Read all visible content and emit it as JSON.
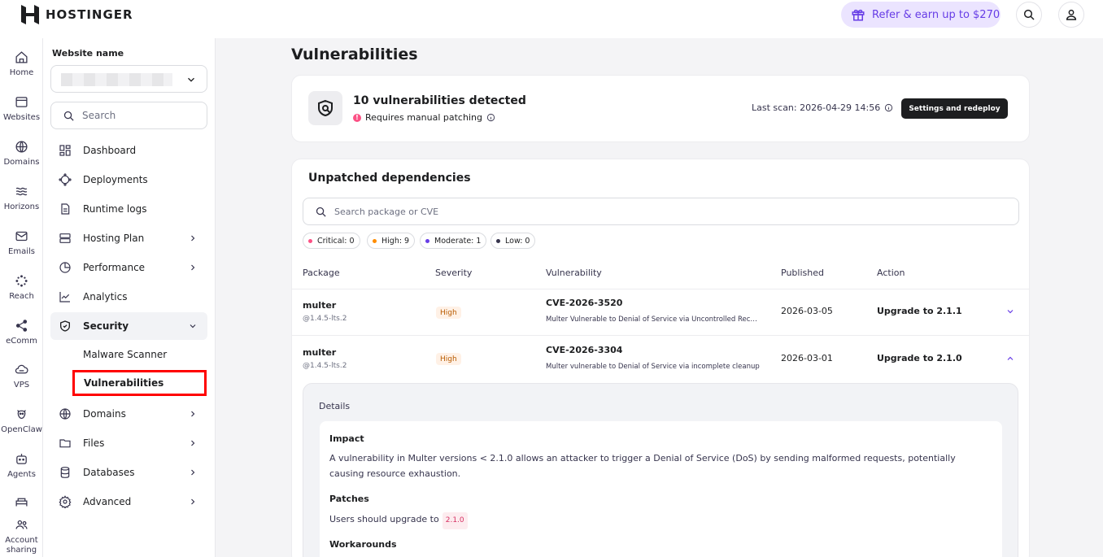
{
  "brand": {
    "name": "HOSTINGER"
  },
  "header": {
    "refer_label": "Refer & earn up to $270"
  },
  "rail": [
    {
      "label": "Home",
      "icon": "home-icon"
    },
    {
      "label": "Websites",
      "icon": "websites-icon"
    },
    {
      "label": "Domains",
      "icon": "globe-icon"
    },
    {
      "label": "Horizons",
      "icon": "horizons-icon"
    },
    {
      "label": "Emails",
      "icon": "mail-icon"
    },
    {
      "label": "Reach",
      "icon": "reach-icon"
    },
    {
      "label": "eComm",
      "icon": "ecomm-icon"
    },
    {
      "label": "VPS",
      "icon": "vps-icon"
    },
    {
      "label": "OpenClaw",
      "icon": "openclaw-icon"
    },
    {
      "label": "Agents",
      "icon": "agents-icon"
    },
    {
      "label": "",
      "icon": "bed-icon"
    },
    {
      "label": "Account sharing",
      "icon": "account-sharing-icon"
    }
  ],
  "sidebar": {
    "website_label": "Website name",
    "search_placeholder": "Search",
    "items": [
      {
        "label": "Dashboard"
      },
      {
        "label": "Deployments"
      },
      {
        "label": "Runtime logs"
      },
      {
        "label": "Hosting Plan"
      },
      {
        "label": "Performance"
      },
      {
        "label": "Analytics"
      },
      {
        "label": "Security"
      },
      {
        "label": "Domains"
      },
      {
        "label": "Files"
      },
      {
        "label": "Databases"
      },
      {
        "label": "Advanced"
      }
    ],
    "security_sub": [
      {
        "label": "Malware Scanner"
      },
      {
        "label": "Vulnerabilities"
      }
    ]
  },
  "page": {
    "title": "Vulnerabilities"
  },
  "scan": {
    "count_text": "10 vulnerabilities detected",
    "status_text": "Requires manual patching",
    "last_scan": "Last scan: 2026-04-29 14:56",
    "button": "Settings and redeploy"
  },
  "deps": {
    "title": "Unpatched dependencies",
    "search_placeholder": "Search package or CVE",
    "chips": [
      {
        "label": "Critical: 0",
        "color": "#fc5185"
      },
      {
        "label": "High: 9",
        "color": "#ff8c00"
      },
      {
        "label": "Moderate: 1",
        "color": "#673de6"
      },
      {
        "label": "Low: 0",
        "color": "#36344d"
      }
    ],
    "columns": [
      "Package",
      "Severity",
      "Vulnerability",
      "Published",
      "Action"
    ],
    "rows": [
      {
        "package": "multer",
        "version": "@1.4.5-lts.2",
        "severity": "High",
        "cve": "CVE-2026-3520",
        "desc": "Multer Vulnerable to Denial of Service via Uncontrolled Recursion",
        "published": "2026-03-05",
        "action": "Upgrade to 2.1.1"
      },
      {
        "package": "multer",
        "version": "@1.4.5-lts.2",
        "severity": "High",
        "cve": "CVE-2026-3304",
        "desc": "Multer vulnerable to Denial of Service via incomplete cleanup",
        "published": "2026-03-01",
        "action": "Upgrade to 2.1.0"
      }
    ],
    "details": {
      "label": "Details",
      "impact_title": "Impact",
      "impact_text": "A vulnerability in Multer versions < 2.1.0 allows an attacker to trigger a Denial of Service (DoS) by sending malformed requests, potentially causing resource exhaustion.",
      "patches_title": "Patches",
      "patches_text": "Users should upgrade to",
      "patches_version": "2.1.0",
      "workarounds_title": "Workarounds"
    }
  }
}
